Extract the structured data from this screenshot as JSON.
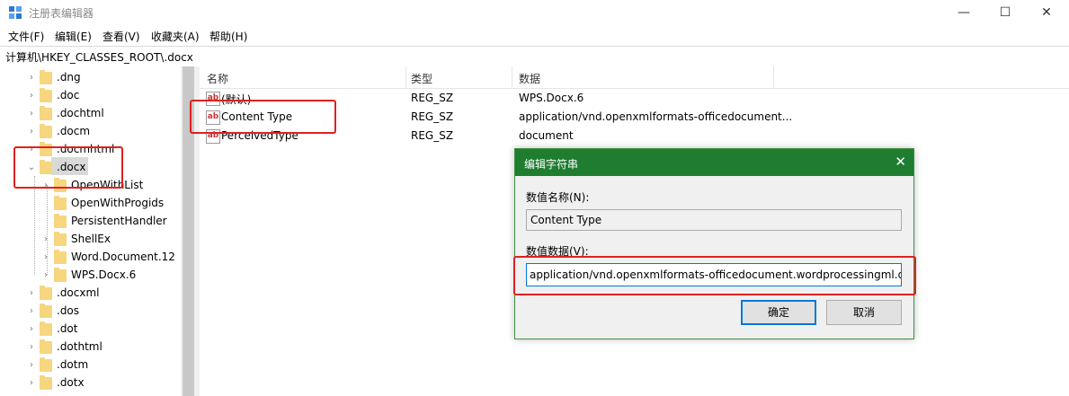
{
  "window": {
    "title": "注册表编辑器",
    "minimize": "—",
    "maximize": "☐",
    "close": "✕"
  },
  "menu": [
    "文件(F)",
    "编辑(E)",
    "查看(V)",
    "收藏夹(A)",
    "帮助(H)"
  ],
  "address": "计算机\\HKEY_CLASSES_ROOT\\.docx",
  "tree": [
    {
      "label": ".dng",
      "expander": "›"
    },
    {
      "label": ".doc",
      "expander": "›"
    },
    {
      "label": ".dochtml",
      "expander": "›"
    },
    {
      "label": ".docm",
      "expander": "›"
    },
    {
      "label": ".docmhtml",
      "expander": "›"
    },
    {
      "label": ".docx",
      "expander": "⌄",
      "selected": true
    },
    {
      "label": "OpenWithList",
      "expander": "›",
      "child": true
    },
    {
      "label": "OpenWithProgids",
      "expander": "",
      "child": true
    },
    {
      "label": "PersistentHandler",
      "expander": "",
      "child": true
    },
    {
      "label": "ShellEx",
      "expander": "›",
      "child": true
    },
    {
      "label": "Word.Document.12",
      "expander": "›",
      "child": true
    },
    {
      "label": "WPS.Docx.6",
      "expander": "›",
      "child": true
    },
    {
      "label": ".docxml",
      "expander": "›"
    },
    {
      "label": ".dos",
      "expander": "›"
    },
    {
      "label": ".dot",
      "expander": "›"
    },
    {
      "label": ".dothtml",
      "expander": "›"
    },
    {
      "label": ".dotm",
      "expander": "›"
    },
    {
      "label": ".dotx",
      "expander": "›"
    }
  ],
  "columns": {
    "name": "名称",
    "type": "类型",
    "data": "数据"
  },
  "values": [
    {
      "name": "(默认)",
      "type": "REG_SZ",
      "data": "WPS.Docx.6"
    },
    {
      "name": "Content Type",
      "type": "REG_SZ",
      "data": "application/vnd.openxmlformats-officedocument..."
    },
    {
      "name": "PerceivedType",
      "type": "REG_SZ",
      "data": "document"
    }
  ],
  "dialog": {
    "title": "编辑字符串",
    "close": "✕",
    "name_label": "数值名称(N):",
    "name_value": "Content Type",
    "data_label": "数值数据(V):",
    "data_value": "application/vnd.openxmlformats-officedocument.wordprocessingml.do",
    "ok": "确定",
    "cancel": "取消"
  },
  "colors": {
    "highlight": "#e02020",
    "dialog_title": "#1e7d2f",
    "focus": "#0078d7"
  }
}
